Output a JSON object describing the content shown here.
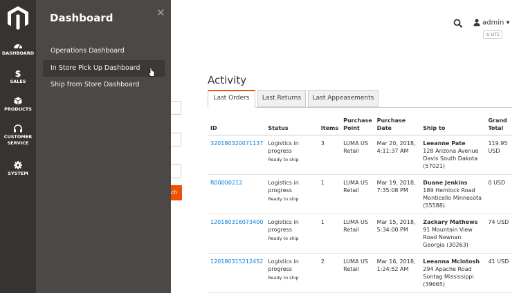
{
  "rail": {
    "items": [
      {
        "label": "Dashboard",
        "icon": "dashboard-icon"
      },
      {
        "label": "Sales",
        "icon": "dollar-icon"
      },
      {
        "label": "Products",
        "icon": "cube-icon"
      },
      {
        "label": "Customer Service",
        "icon": "headset-icon"
      },
      {
        "label": "System",
        "icon": "gear-icon"
      }
    ]
  },
  "flyout": {
    "title": "Dashboard",
    "close": "×",
    "items": [
      {
        "label": "Operations Dashboard"
      },
      {
        "label": "In Store Pick Up Dashboard"
      },
      {
        "label": "Ship from Store Dashboard"
      }
    ]
  },
  "header": {
    "user": "admin ▾",
    "timezone": "UTC"
  },
  "partial_button": "ch",
  "activity": {
    "title": "Activity",
    "tabs": [
      {
        "label": "Last Orders"
      },
      {
        "label": "Last Returns"
      },
      {
        "label": "Last Appeasements"
      }
    ],
    "columns": [
      "ID",
      "Status",
      "Items",
      "Purchase Point",
      "Purchase Date",
      "Ship to",
      "Grand Total"
    ],
    "rows": [
      {
        "id": "320180320071137",
        "status": "Logistics in progress",
        "status_sub": "Ready to ship",
        "items": "3",
        "point": "LUMA US Retail",
        "date": "Mar 20, 2018, 4:11:37 AM",
        "ship_name": "Leeanne Pate",
        "ship_addr": "128 Arizona Avenue Davis South Dakota (57021)",
        "total": "119.95 USD"
      },
      {
        "id": "R00000212",
        "status": "Logistics in progress",
        "status_sub": "Ready to ship",
        "items": "1",
        "point": "LUMA US Retail",
        "date": "Mar 19, 2018, 7:35:08 PM",
        "ship_name": "Duane Jenkins",
        "ship_addr": "189 Hemlock Road Monticello Minnesota (55588)",
        "total": "0 USD"
      },
      {
        "id": "120180316073400",
        "status": "Logistics in progress",
        "status_sub": "Ready to ship",
        "items": "1",
        "point": "LUMA US Retail",
        "date": "Mar 15, 2018, 5:34:00 PM",
        "ship_name": "Zackary Mathews",
        "ship_addr": "91 Mountain View Road Newnan Georgia (30263)",
        "total": "74 USD"
      },
      {
        "id": "120180315212452",
        "status": "Logistics in progress",
        "status_sub": "Ready to ship",
        "items": "2",
        "point": "LUMA US Retail",
        "date": "Mar 16, 2018, 1:24:52 AM",
        "ship_name": "Leeanna Mcintosh",
        "ship_addr": "294 Apache Road Sontag Mississippi (39665)",
        "total": "41 USD"
      }
    ]
  }
}
